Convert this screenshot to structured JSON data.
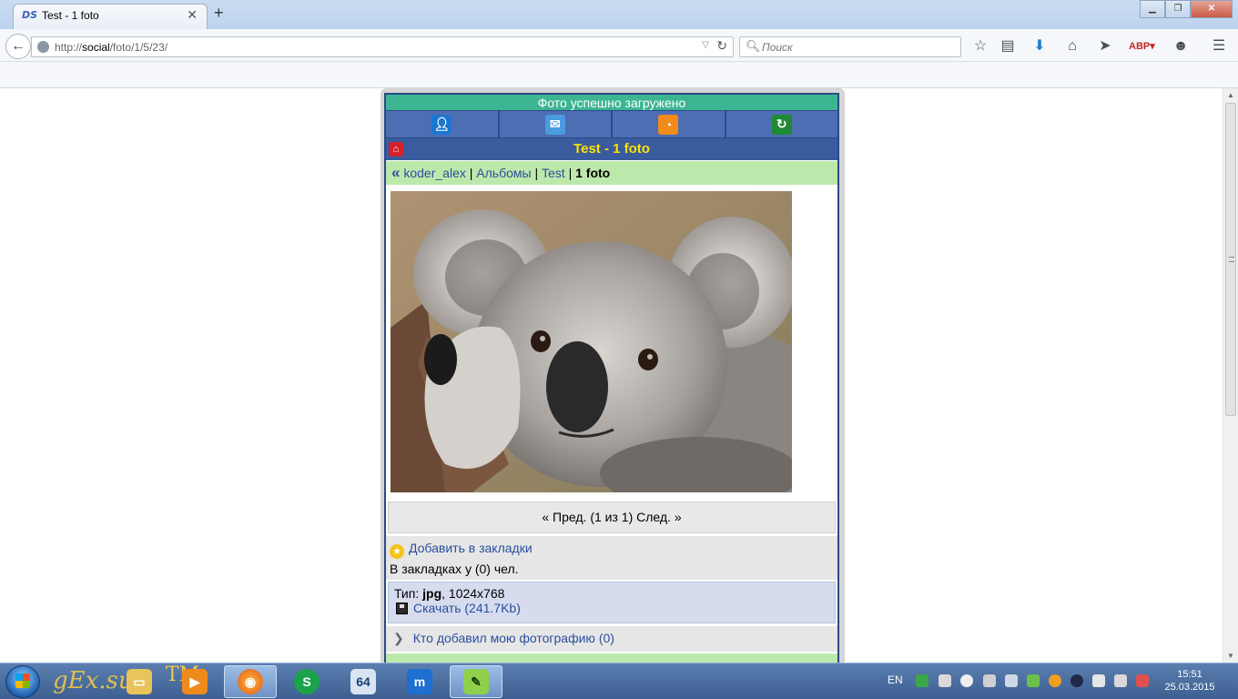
{
  "browser": {
    "tab_title": "Test - 1 foto",
    "tab_favicon": "DS",
    "url_prefix": "http://",
    "url_host": "social",
    "url_path": "/foto/1/5/23/",
    "search_placeholder": "Поиск"
  },
  "page": {
    "message": "Фото успешно загружено",
    "nav_icons": [
      "user-icon",
      "mail-icon",
      "rss-icon",
      "refresh-icon"
    ],
    "title": "Test - 1 foto",
    "breadcrumb": {
      "back": "«",
      "user": "koder_alex",
      "albums": "Альбомы",
      "album": "Test",
      "current": "1 foto",
      "sep": "|"
    },
    "pager": {
      "prev": "« Пред.",
      "position": "(1 из 1)",
      "next": "След. »"
    },
    "bookmarks": {
      "add": "Добавить в закладки",
      "count_text": "В закладках у (0) чел."
    },
    "file": {
      "type_label": "Тип:",
      "type": "jpg",
      "dims": ", 1024x768",
      "download": "Скачать (241.7Kb)"
    },
    "who_added": "Кто добавил мою фотографию (0)"
  },
  "taskbar": {
    "watermark": "gEx.su",
    "watermark_tm": "TM",
    "lang": "EN",
    "time": "15:51",
    "date": "25.03.2015"
  },
  "colors": {
    "success": "#3cb592",
    "nav_blue": "#2b4a87",
    "title_yellow": "#ffe200",
    "breadcrumb_green": "#bde8ab",
    "link": "#2a4f9e"
  }
}
